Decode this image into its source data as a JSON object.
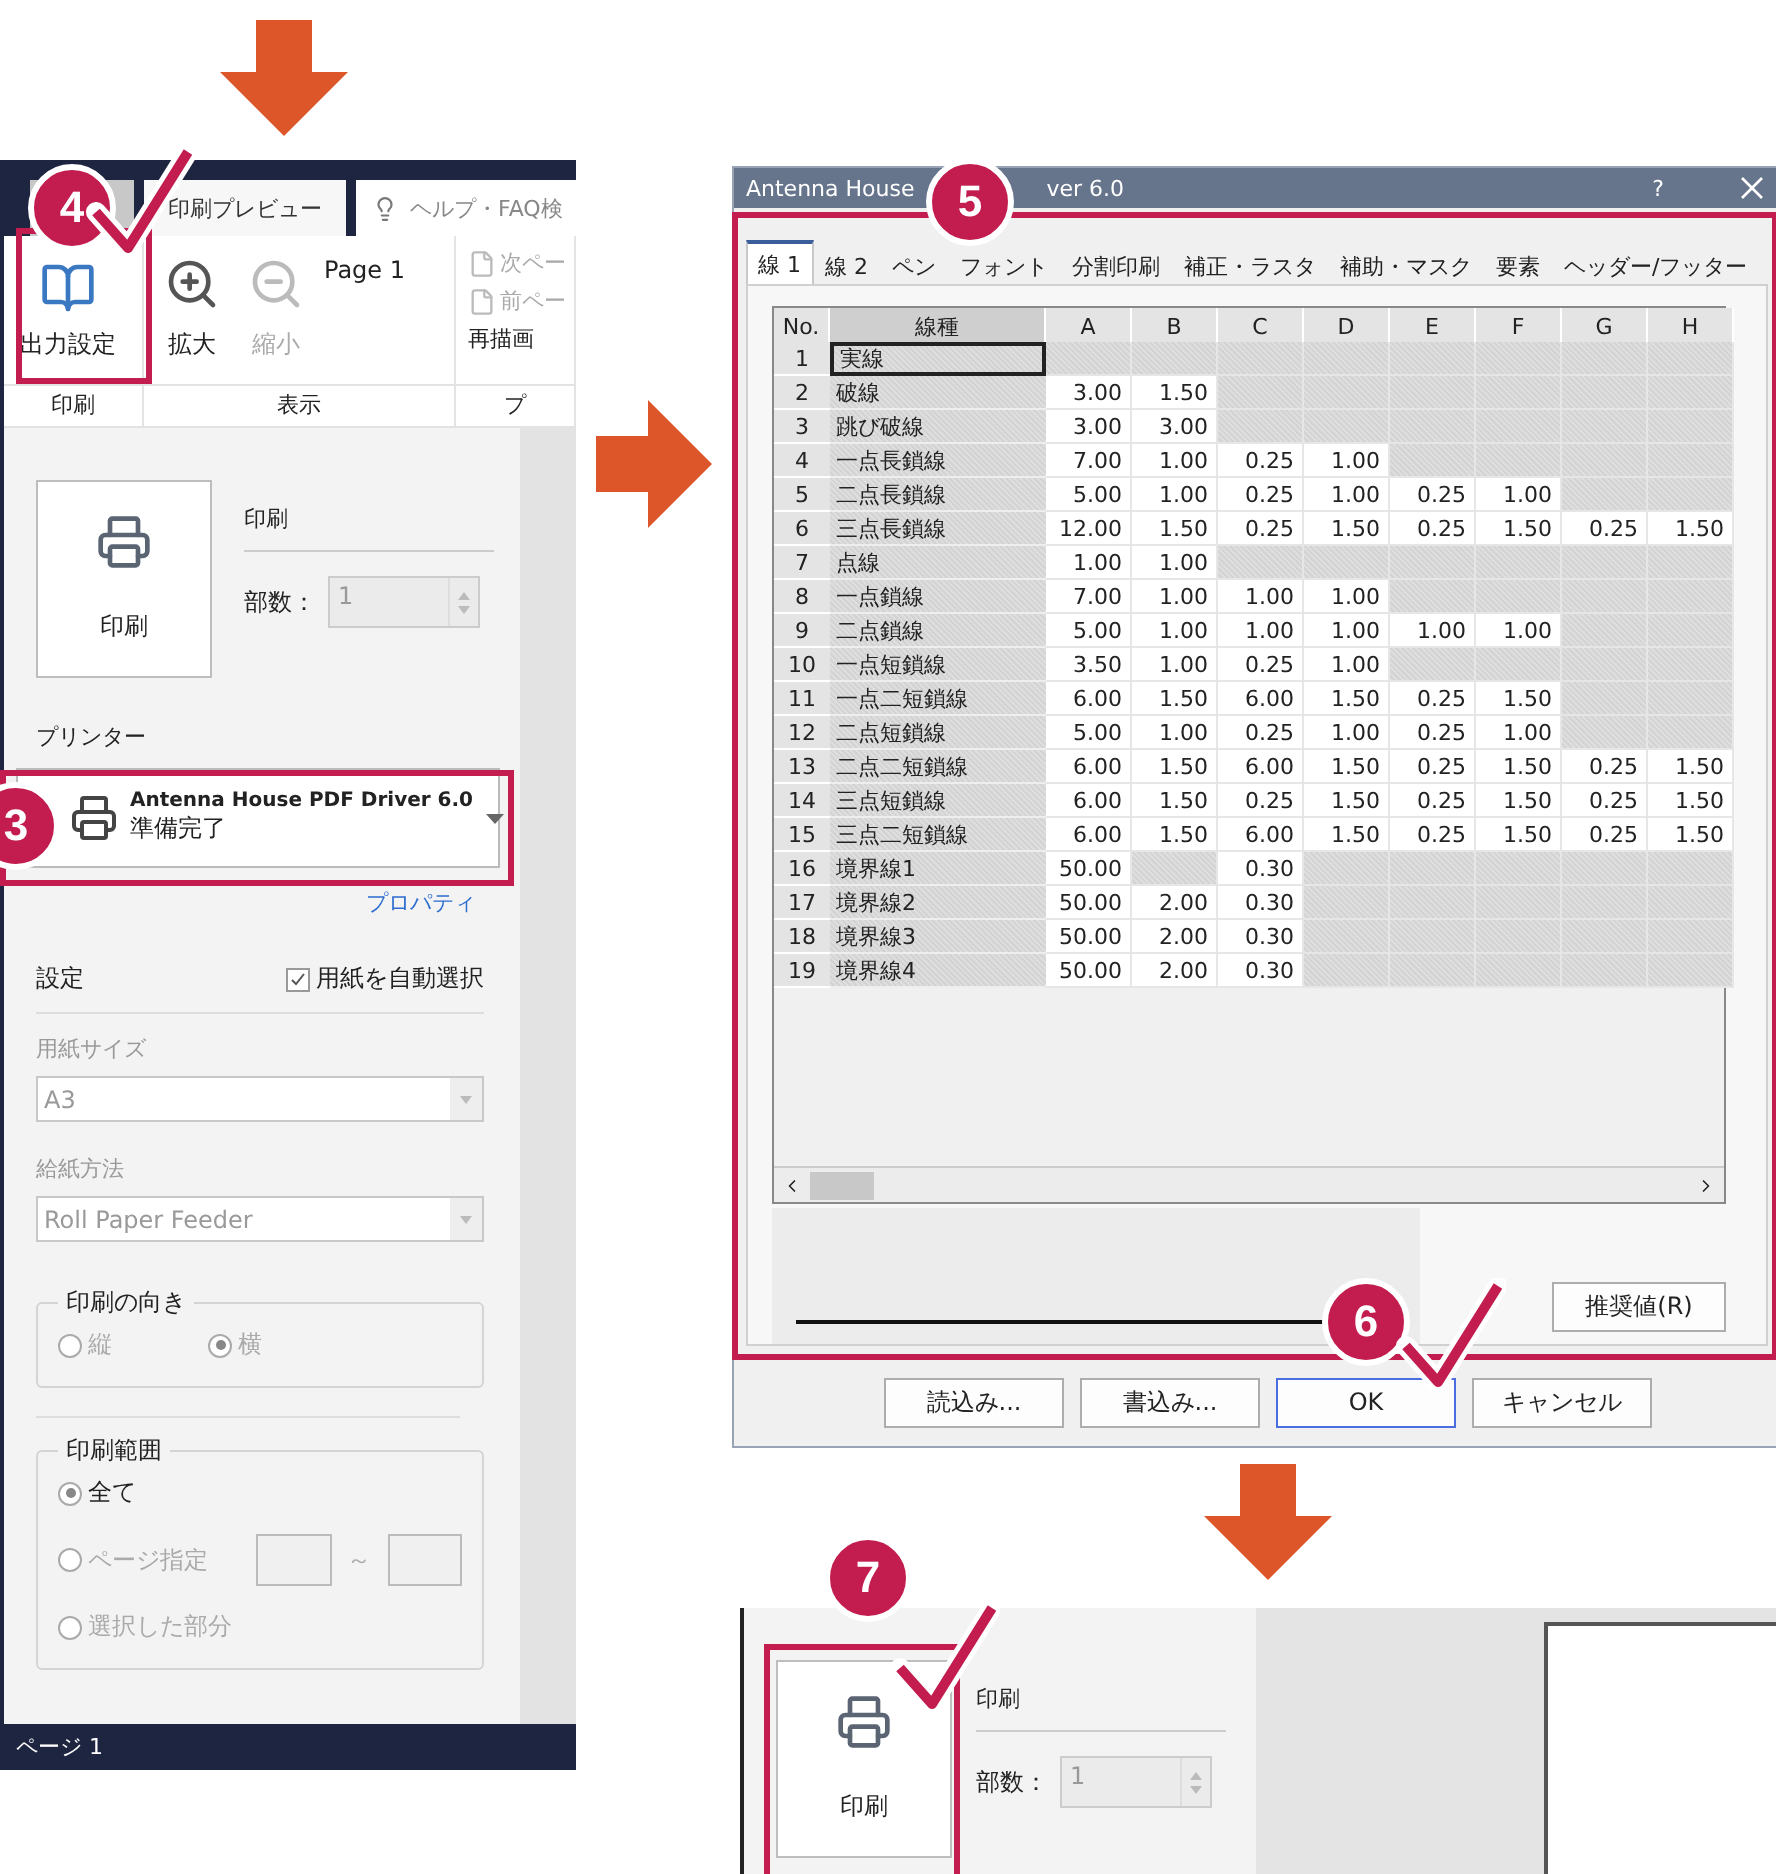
{
  "preview_window": {
    "tabs": [
      {
        "label": "印刷プレビュー",
        "selected": true
      }
    ],
    "search": {
      "placeholder": "ヘルプ・FAQ検"
    },
    "step": {
      "number": "4",
      "checked": true
    },
    "ribbon": {
      "output_settings": "出力設定",
      "page": "Page 1",
      "buttons": [
        {
          "kind": "zoom_in",
          "label": "拡大",
          "disabled": false
        },
        {
          "kind": "zoom_out",
          "label": "縮小",
          "disabled": true
        }
      ],
      "nav": [
        {
          "label": "次ペー",
          "disabled": true
        },
        {
          "label": "前ペー",
          "disabled": true
        }
      ],
      "redraw": "再描画",
      "groups": [
        "印刷",
        "表示",
        "プ"
      ]
    },
    "print_panel": {
      "print_button": "印刷",
      "heading": "印刷",
      "copies_label": "部数：",
      "copies_value": "1",
      "printer_label": "プリンター",
      "printer": {
        "name": "Antenna House PDF Driver 6.0",
        "status": "準備完了",
        "step": {
          "number": "3",
          "checked": false
        }
      },
      "properties_link": "プロパティ",
      "settings_label": "設定",
      "auto_paper": {
        "label": "用紙を自動選択",
        "checked": true
      },
      "paper_size_label": "用紙サイズ",
      "paper_size": "A3",
      "feed_label": "給紙方法",
      "feed": "Roll Paper Feeder",
      "orientation": {
        "title": "印刷の向き",
        "options": [
          {
            "label": "縦",
            "selected": false,
            "disabled": true
          },
          {
            "label": "横",
            "selected": true,
            "disabled": true
          }
        ]
      },
      "range": {
        "title": "印刷範囲",
        "options": [
          {
            "label": "全て",
            "selected": true,
            "disabled": false
          },
          {
            "label": "ページ指定",
            "selected": false,
            "disabled": true
          },
          {
            "label": "選択した部分",
            "selected": false,
            "disabled": true
          }
        ],
        "separator": "～"
      }
    },
    "status_bar": "ページ 1"
  },
  "dialog": {
    "title_parts": [
      "Antenna House",
      "ver 6.0"
    ],
    "help": "?",
    "step": {
      "number": "5",
      "checked": false
    },
    "tabs": [
      {
        "label": "線 1",
        "selected": true
      },
      {
        "label": "線 2",
        "selected": false
      },
      {
        "label": "ペン",
        "selected": false
      },
      {
        "label": "フォント",
        "selected": false
      },
      {
        "label": "分割印刷",
        "selected": false
      },
      {
        "label": "補正・ラスタ",
        "selected": false
      },
      {
        "label": "補助・マスク",
        "selected": false
      },
      {
        "label": "要素",
        "selected": false
      },
      {
        "label": "ヘッダー/フッター",
        "selected": false
      }
    ],
    "header_columns": [
      "No.",
      "線種"
    ],
    "value_columns": [
      "A",
      "B",
      "C",
      "D",
      "E",
      "F",
      "G",
      "H"
    ],
    "rows": [
      {
        "no": "1",
        "name": "実線",
        "selected": true,
        "cells": [
          {
            "disabled": true
          },
          {
            "disabled": true
          },
          {
            "disabled": true
          },
          {
            "disabled": true
          },
          {
            "disabled": true
          },
          {
            "disabled": true
          },
          {
            "disabled": true
          },
          {
            "disabled": true
          }
        ]
      },
      {
        "no": "2",
        "name": "破線",
        "selected": false,
        "cells": [
          {
            "text": "3.00"
          },
          {
            "text": "1.50"
          },
          {
            "disabled": true
          },
          {
            "disabled": true
          },
          {
            "disabled": true
          },
          {
            "disabled": true
          },
          {
            "disabled": true
          },
          {
            "disabled": true
          }
        ]
      },
      {
        "no": "3",
        "name": "跳び破線",
        "selected": false,
        "cells": [
          {
            "text": "3.00"
          },
          {
            "text": "3.00"
          },
          {
            "disabled": true
          },
          {
            "disabled": true
          },
          {
            "disabled": true
          },
          {
            "disabled": true
          },
          {
            "disabled": true
          },
          {
            "disabled": true
          }
        ]
      },
      {
        "no": "4",
        "name": "一点長鎖線",
        "selected": false,
        "cells": [
          {
            "text": "7.00"
          },
          {
            "text": "1.00"
          },
          {
            "text": "0.25"
          },
          {
            "text": "1.00"
          },
          {
            "disabled": true
          },
          {
            "disabled": true
          },
          {
            "disabled": true
          },
          {
            "disabled": true
          }
        ]
      },
      {
        "no": "5",
        "name": "二点長鎖線",
        "selected": false,
        "cells": [
          {
            "text": "5.00"
          },
          {
            "text": "1.00"
          },
          {
            "text": "0.25"
          },
          {
            "text": "1.00"
          },
          {
            "text": "0.25"
          },
          {
            "text": "1.00"
          },
          {
            "disabled": true
          },
          {
            "disabled": true
          }
        ]
      },
      {
        "no": "6",
        "name": "三点長鎖線",
        "selected": false,
        "cells": [
          {
            "text": "12.00"
          },
          {
            "text": "1.50"
          },
          {
            "text": "0.25"
          },
          {
            "text": "1.50"
          },
          {
            "text": "0.25"
          },
          {
            "text": "1.50"
          },
          {
            "text": "0.25"
          },
          {
            "text": "1.50"
          }
        ]
      },
      {
        "no": "7",
        "name": "点線",
        "selected": false,
        "cells": [
          {
            "text": "1.00"
          },
          {
            "text": "1.00"
          },
          {
            "disabled": true
          },
          {
            "disabled": true
          },
          {
            "disabled": true
          },
          {
            "disabled": true
          },
          {
            "disabled": true
          },
          {
            "disabled": true
          }
        ]
      },
      {
        "no": "8",
        "name": "一点鎖線",
        "selected": false,
        "cells": [
          {
            "text": "7.00"
          },
          {
            "text": "1.00"
          },
          {
            "text": "1.00"
          },
          {
            "text": "1.00"
          },
          {
            "disabled": true
          },
          {
            "disabled": true
          },
          {
            "disabled": true
          },
          {
            "disabled": true
          }
        ]
      },
      {
        "no": "9",
        "name": "二点鎖線",
        "selected": false,
        "cells": [
          {
            "text": "5.00"
          },
          {
            "text": "1.00"
          },
          {
            "text": "1.00"
          },
          {
            "text": "1.00"
          },
          {
            "text": "1.00"
          },
          {
            "text": "1.00"
          },
          {
            "disabled": true
          },
          {
            "disabled": true
          }
        ]
      },
      {
        "no": "10",
        "name": "一点短鎖線",
        "selected": false,
        "cells": [
          {
            "text": "3.50"
          },
          {
            "text": "1.00"
          },
          {
            "text": "0.25"
          },
          {
            "text": "1.00"
          },
          {
            "disabled": true
          },
          {
            "disabled": true
          },
          {
            "disabled": true
          },
          {
            "disabled": true
          }
        ]
      },
      {
        "no": "11",
        "name": "一点二短鎖線",
        "selected": false,
        "cells": [
          {
            "text": "6.00"
          },
          {
            "text": "1.50"
          },
          {
            "text": "6.00"
          },
          {
            "text": "1.50"
          },
          {
            "text": "0.25"
          },
          {
            "text": "1.50"
          },
          {
            "disabled": true
          },
          {
            "disabled": true
          }
        ]
      },
      {
        "no": "12",
        "name": "二点短鎖線",
        "selected": false,
        "cells": [
          {
            "text": "5.00"
          },
          {
            "text": "1.00"
          },
          {
            "text": "0.25"
          },
          {
            "text": "1.00"
          },
          {
            "text": "0.25"
          },
          {
            "text": "1.00"
          },
          {
            "disabled": true
          },
          {
            "disabled": true
          }
        ]
      },
      {
        "no": "13",
        "name": "二点二短鎖線",
        "selected": false,
        "cells": [
          {
            "text": "6.00"
          },
          {
            "text": "1.50"
          },
          {
            "text": "6.00"
          },
          {
            "text": "1.50"
          },
          {
            "text": "0.25"
          },
          {
            "text": "1.50"
          },
          {
            "text": "0.25"
          },
          {
            "text": "1.50"
          }
        ]
      },
      {
        "no": "14",
        "name": "三点短鎖線",
        "selected": false,
        "cells": [
          {
            "text": "6.00"
          },
          {
            "text": "1.50"
          },
          {
            "text": "0.25"
          },
          {
            "text": "1.50"
          },
          {
            "text": "0.25"
          },
          {
            "text": "1.50"
          },
          {
            "text": "0.25"
          },
          {
            "text": "1.50"
          }
        ]
      },
      {
        "no": "15",
        "name": "三点二短鎖線",
        "selected": false,
        "cells": [
          {
            "text": "6.00"
          },
          {
            "text": "1.50"
          },
          {
            "text": "6.00"
          },
          {
            "text": "1.50"
          },
          {
            "text": "0.25"
          },
          {
            "text": "1.50"
          },
          {
            "text": "0.25"
          },
          {
            "text": "1.50"
          }
        ]
      },
      {
        "no": "16",
        "name": "境界線1",
        "selected": false,
        "cells": [
          {
            "text": "50.00"
          },
          {
            "disabled": true
          },
          {
            "text": "0.30"
          },
          {
            "disabled": true
          },
          {
            "disabled": true
          },
          {
            "disabled": true
          },
          {
            "disabled": true
          },
          {
            "disabled": true
          }
        ]
      },
      {
        "no": "17",
        "name": "境界線2",
        "selected": false,
        "cells": [
          {
            "text": "50.00"
          },
          {
            "text": "2.00"
          },
          {
            "text": "0.30"
          },
          {
            "disabled": true
          },
          {
            "disabled": true
          },
          {
            "disabled": true
          },
          {
            "disabled": true
          },
          {
            "disabled": true
          }
        ]
      },
      {
        "no": "18",
        "name": "境界線3",
        "selected": false,
        "cells": [
          {
            "text": "50.00"
          },
          {
            "text": "2.00"
          },
          {
            "text": "0.30"
          },
          {
            "disabled": true
          },
          {
            "disabled": true
          },
          {
            "disabled": true
          },
          {
            "disabled": true
          },
          {
            "disabled": true
          }
        ]
      },
      {
        "no": "19",
        "name": "境界線4",
        "selected": false,
        "cells": [
          {
            "text": "50.00"
          },
          {
            "text": "2.00"
          },
          {
            "text": "0.30"
          },
          {
            "disabled": true
          },
          {
            "disabled": true
          },
          {
            "disabled": true
          },
          {
            "disabled": true
          },
          {
            "disabled": true
          }
        ]
      }
    ],
    "recommend_button": "推奨値(R)",
    "buttons": [
      {
        "label": "読込み...",
        "default": false
      },
      {
        "label": "書込み...",
        "default": false
      },
      {
        "label": "OK",
        "default": true,
        "step": {
          "number": "6",
          "checked": true
        }
      },
      {
        "label": "キャンセル",
        "default": false
      }
    ]
  },
  "result_panel": {
    "print_button": "印刷",
    "heading": "印刷",
    "copies_label": "部数：",
    "copies_value": "1",
    "step": {
      "number": "7",
      "checked": true
    }
  }
}
